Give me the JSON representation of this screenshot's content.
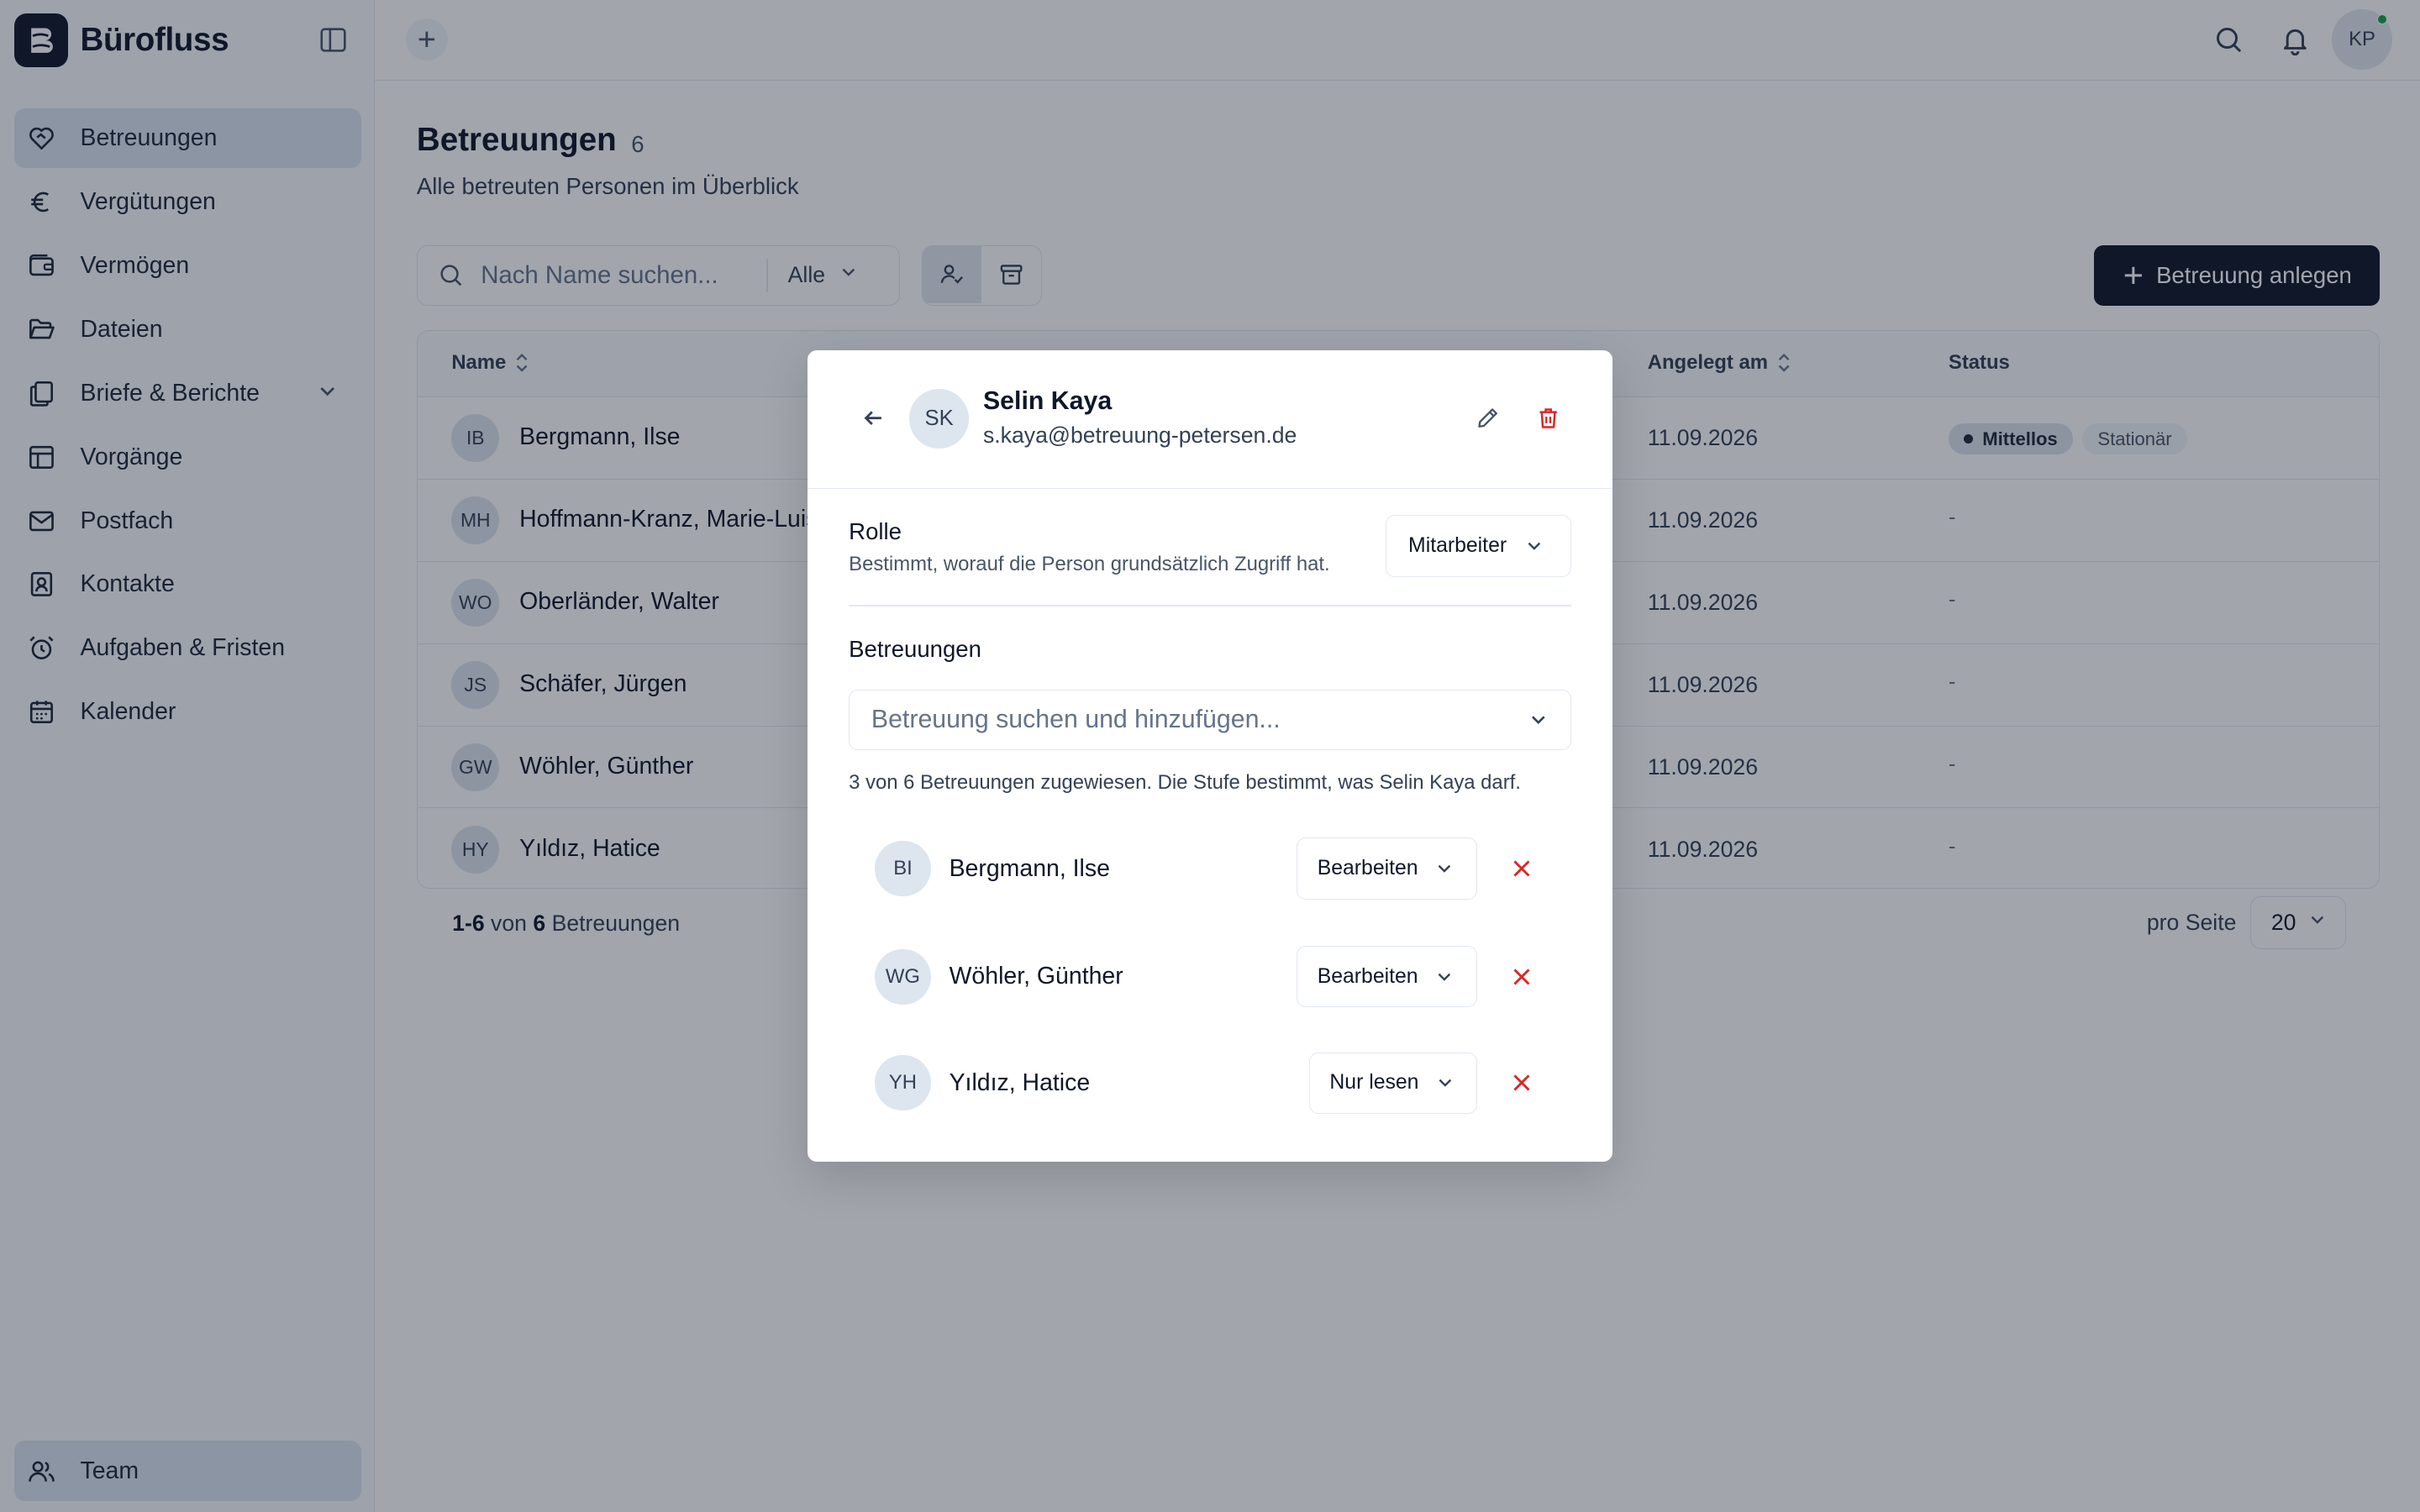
{
  "app": {
    "name": "Bürofluss"
  },
  "sidebar": {
    "items": [
      {
        "label": "Betreuungen",
        "icon": "heart-handshake-icon",
        "active": true
      },
      {
        "label": "Vergütungen",
        "icon": "euro-icon"
      },
      {
        "label": "Vermögen",
        "icon": "wallet-icon"
      },
      {
        "label": "Dateien",
        "icon": "folder-open-icon"
      },
      {
        "label": "Briefe & Berichte",
        "icon": "files-icon",
        "expandable": true
      },
      {
        "label": "Vorgänge",
        "icon": "table-icon"
      },
      {
        "label": "Postfach",
        "icon": "mail-icon"
      },
      {
        "label": "Kontakte",
        "icon": "contact-icon"
      },
      {
        "label": "Aufgaben & Fristen",
        "icon": "alarm-clock-icon"
      },
      {
        "label": "Kalender",
        "icon": "calendar-icon"
      }
    ],
    "bottom": {
      "label": "Team",
      "icon": "users-icon",
      "active": true
    }
  },
  "topbar": {
    "user_initials": "KP"
  },
  "page": {
    "title": "Betreuungen",
    "count": "6",
    "subtitle": "Alle betreuten Personen im Überblick",
    "search_placeholder": "Nach Name suchen...",
    "filter_value": "Alle",
    "primary_button": "Betreuung anlegen"
  },
  "table": {
    "columns": {
      "name": "Name",
      "created": "Angelegt am",
      "status": "Status"
    },
    "rows": [
      {
        "initials": "IB",
        "name": "Bergmann, Ilse",
        "created": "11.09.2026",
        "status": "",
        "badges": [
          "Mittellos",
          "Stationär"
        ]
      },
      {
        "initials": "MH",
        "name": "Hoffmann-Kranz, Marie-Luise",
        "created": "11.09.2026",
        "status": "-"
      },
      {
        "initials": "WO",
        "name": "Oberländer, Walter",
        "created": "11.09.2026",
        "status": "-"
      },
      {
        "initials": "JS",
        "name": "Schäfer, Jürgen",
        "created": "11.09.2026",
        "status": "-"
      },
      {
        "initials": "GW",
        "name": "Wöhler, Günther",
        "created": "11.09.2026",
        "status": "-"
      },
      {
        "initials": "HY",
        "name": "Yıldız, Hatice",
        "created": "11.09.2026",
        "status": "-"
      }
    ]
  },
  "pagination": {
    "range": "1-6",
    "of": "von",
    "total": "6",
    "unit": "Betreuungen",
    "per_page_label": "pro Seite",
    "per_page": "20"
  },
  "modal": {
    "initials": "SK",
    "name": "Selin Kaya",
    "email": "s.kaya@betreuung-petersen.de",
    "role_title": "Rolle",
    "role_desc": "Bestimmt, worauf die Person grundsätzlich Zugriff hat.",
    "role_value": "Mitarbeiter",
    "section_title": "Betreuungen",
    "search_placeholder": "Betreuung suchen und hinzufügen...",
    "assign_info": "3 von 6 Betreuungen zugewiesen. Die Stufe bestimmt, was Selin Kaya darf.",
    "assignments": [
      {
        "initials": "BI",
        "name": "Bergmann, Ilse",
        "permission": "Bearbeiten"
      },
      {
        "initials": "WG",
        "name": "Wöhler, Günther",
        "permission": "Bearbeiten"
      },
      {
        "initials": "YH",
        "name": "Yıldız, Hatice",
        "permission": "Nur lesen"
      }
    ]
  },
  "colors": {
    "primary": "#0f172a",
    "danger": "#dc2626",
    "online": "#16a34a",
    "active_nav": "#dbe5f1"
  }
}
